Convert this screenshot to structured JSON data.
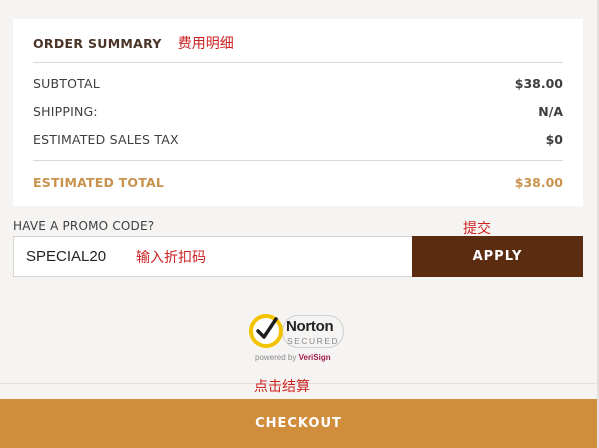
{
  "order_summary": {
    "title": "ORDER SUMMARY",
    "annotation": "费用明细",
    "rows": [
      {
        "label": "SUBTOTAL",
        "value": "$38.00"
      },
      {
        "label": "SHIPPING:",
        "value": "N/A"
      },
      {
        "label": "ESTIMATED SALES TAX",
        "value": "$0"
      }
    ],
    "total": {
      "label": "ESTIMATED TOTAL",
      "value": "$38.00"
    }
  },
  "promo": {
    "label": "HAVE A PROMO CODE?",
    "submit_annotation": "提交",
    "input_value": "SPECIAL20",
    "input_annotation": "输入折扣码",
    "apply_label": "APPLY"
  },
  "norton": {
    "name": "Norton",
    "secured": "SECURED",
    "powered_by": "powered by",
    "verisign": "VeriSign"
  },
  "checkout": {
    "annotation": "点击结算",
    "button_label": "CHECKOUT"
  },
  "colors": {
    "apply_bg": "#5c2c10",
    "checkout_bg": "#d08d3c",
    "total_text": "#c9924d",
    "annotation_text": "#cc2222"
  }
}
